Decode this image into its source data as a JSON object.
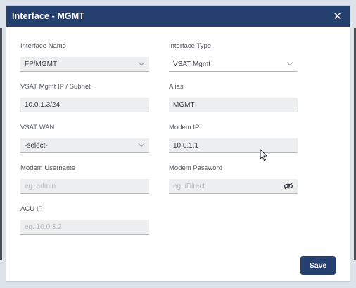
{
  "dialog": {
    "title": "Interface - MGMT",
    "close_glyph": "✕",
    "save_label": "Save"
  },
  "fields": {
    "interface_name": {
      "label": "Interface Name",
      "value": "FP/MGMT"
    },
    "interface_type": {
      "label": "Interface Type",
      "value": "VSAT Mgmt"
    },
    "vsat_mgmt_ip": {
      "label": "VSAT Mgmt IP / Subnet",
      "value": "10.0.1.3/24"
    },
    "alias": {
      "label": "Alias",
      "value": "MGMT"
    },
    "vsat_wan": {
      "label": "VSAT WAN",
      "value": "-select-"
    },
    "modem_ip": {
      "label": "Modem IP",
      "value": "10.0.1.1"
    },
    "modem_username": {
      "label": "Modem Username",
      "placeholder": "eg. admin"
    },
    "modem_password": {
      "label": "Modem Password",
      "placeholder": "eg. iDirect"
    },
    "acu_ip": {
      "label": "ACU IP",
      "placeholder": "eg. 10.0.3.2"
    }
  },
  "colors": {
    "primary": "#253f6e",
    "field_background": "#eceef0",
    "field_underline": "#98c2d6"
  },
  "icons": [
    "close-icon",
    "chevron-down-icon",
    "eye-slash-icon",
    "mouse-cursor-icon"
  ]
}
